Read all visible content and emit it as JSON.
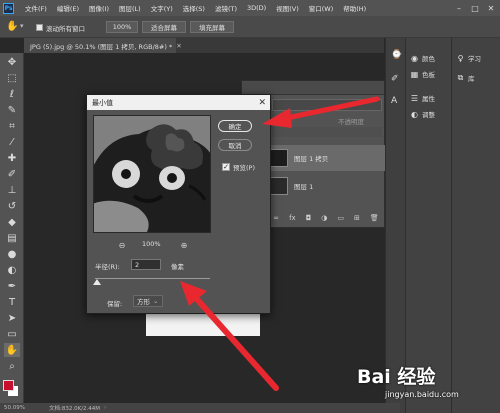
{
  "app": {
    "logo": "Ps"
  },
  "menubar": {
    "items": [
      "文件(F)",
      "编辑(E)",
      "图像(I)",
      "图层(L)",
      "文字(Y)",
      "选择(S)",
      "滤镜(T)",
      "3D(D)",
      "视图(V)",
      "窗口(W)",
      "帮助(H)"
    ],
    "window_controls": [
      "–",
      "□",
      "✕"
    ]
  },
  "options": {
    "scroll_all": "滚动所有窗口",
    "zoom": "100%",
    "fit_screen": "适合屏幕",
    "fill_screen": "填充屏幕"
  },
  "document": {
    "tab_title": "JPG (5).jpg @ 50.1% (图层 1 拷贝, RGB/8#) *",
    "tab_close": "✕"
  },
  "status": {
    "zoom": "50.09%",
    "doc": "文档:832.0K/2.44M"
  },
  "layers": {
    "opacity_label": "不透明度",
    "rows": [
      "图层 1 拷贝",
      "图层 1"
    ]
  },
  "panels": {
    "color": "颜色",
    "swatches": "色板",
    "properties": "属性",
    "adjustments": "调整",
    "learn": "学习",
    "library": "库"
  },
  "dialog": {
    "title": "最小值",
    "close": "✕",
    "ok": "确定",
    "cancel": "取消",
    "preview_label": "预览(P)",
    "zoom": "100%",
    "radius_label": "半径(R):",
    "radius_value": "2",
    "radius_unit": "像素",
    "preserve_label": "保留:",
    "preserve_value": "方形"
  },
  "watermark": {
    "brand": "Bai 经验",
    "url": "jingyan.baidu.com"
  },
  "colors": {
    "menubar": "#535353",
    "panel": "#424242",
    "canvas": "#282828",
    "foreground": "#c8102e",
    "arrow": "#e8282e"
  },
  "icons": [
    "move-tool-icon",
    "marquee-tool-icon",
    "lasso-tool-icon",
    "quick-select-icon",
    "crop-tool-icon",
    "eyedropper-icon",
    "healing-brush-icon",
    "brush-tool-icon",
    "clone-stamp-icon",
    "history-brush-icon",
    "eraser-icon",
    "gradient-icon",
    "blur-icon",
    "dodge-icon",
    "pen-tool-icon",
    "type-tool-icon",
    "path-select-icon",
    "shape-tool-icon",
    "hand-tool-icon",
    "zoom-tool-icon"
  ]
}
